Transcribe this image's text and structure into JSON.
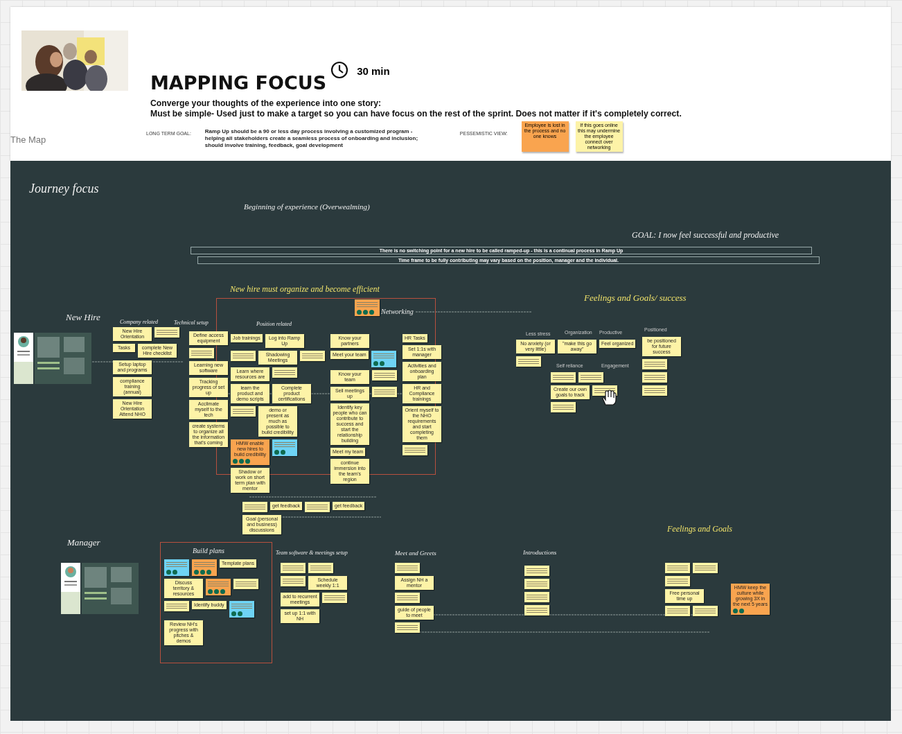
{
  "header": {
    "title": "MAPPING FOCUS",
    "duration": "30 min",
    "instructions": [
      "Converge your thoughts of the experience into one story:",
      "Must be simple- Used just to make a target so you can have focus on the rest of the sprint. Does not matter if it's completely correct."
    ],
    "goal_label": "LONG TERM GOAL:",
    "goal_text": "Ramp Up should be a 90 or less day process involving a customized program - helping all stakeholders create a seamless process of onboarding and inclusion; should involve training, feedback, goal development",
    "pessimistic_label": "PESSEMISTIC VIEW:",
    "pessimistic_notes": [
      {
        "text": "Employee is lost in the process and no one knows",
        "color": "#f9a44f"
      },
      {
        "text": "If this goes online this may undermine the employee connect over networking",
        "color": "#fdf3a7"
      }
    ]
  },
  "frame_label": "The Map",
  "labels": [
    {
      "text": "Journey focus",
      "kind": "script"
    },
    {
      "text": "Beginning of experience (Overwealming)",
      "kind": "script"
    },
    {
      "text": "GOAL:  I now feel successful and productive",
      "kind": "script"
    },
    {
      "text": "New hire must organize and become efficient",
      "kind": "accent"
    },
    {
      "text": "Feelings and Goals/ success",
      "kind": "accent"
    },
    {
      "text": "New Hire",
      "kind": "script"
    },
    {
      "text": "Company related",
      "kind": "script"
    },
    {
      "text": "Technical setup",
      "kind": "script"
    },
    {
      "text": "Position related",
      "kind": "script"
    },
    {
      "text": "Networking",
      "kind": "script"
    },
    {
      "text": "Manager",
      "kind": "script"
    },
    {
      "text": "Build  plans",
      "kind": "script"
    },
    {
      "text": "Team software & meetings setup",
      "kind": "script"
    },
    {
      "text": "Meet and Greets",
      "kind": "script"
    },
    {
      "text": "Introductions",
      "kind": "script"
    },
    {
      "text": "Feelings and Goals",
      "kind": "accent"
    },
    {
      "text": "Less stress",
      "kind": "caption"
    },
    {
      "text": "Organization",
      "kind": "caption"
    },
    {
      "text": "Productive",
      "kind": "caption"
    },
    {
      "text": "Self reliance",
      "kind": "caption"
    },
    {
      "text": "Engagement",
      "kind": "caption"
    },
    {
      "text": "Positioned",
      "kind": "caption"
    }
  ],
  "banners": [
    "There is no switching point for a new hire to be called ramped-up - this is a continual process in Ramp Up",
    "Time frame to be fully contributing may vary based on the position, manager and the individual."
  ],
  "clusters": [
    {
      "notes": [
        {
          "text": "New Hire Orientation",
          "color": "#fdf3a7"
        },
        {
          "color": "#fdf3a7"
        },
        {
          "text": "Tasks",
          "color": "#fdf3a7"
        },
        {
          "text": "complete New Hire checklist",
          "color": "#fdf3a7"
        },
        {
          "text": "Setup laptop and programs",
          "color": "#fdf3a7"
        },
        {
          "text": "compliance training (annual)",
          "color": "#fdf3a7"
        },
        {
          "text": "New Hire Orientation Attend NHO",
          "color": "#fdf3a7"
        }
      ]
    },
    {
      "notes": [
        {
          "text": "Define access equipment",
          "color": "#fdf3a7"
        },
        {
          "color": "#fdf3a7"
        },
        {
          "text": "Learning new software",
          "color": "#fdf3a7"
        },
        {
          "text": "Tracking progress of set up",
          "color": "#fdf3a7"
        },
        {
          "text": "Acclimate myself to the tech",
          "color": "#fdf3a7"
        },
        {
          "text": "create systems to organize all the information that's coming",
          "color": "#fdf3a7"
        }
      ]
    },
    {
      "notes": [
        {
          "text": "Job trainings",
          "color": "#fdf3a7"
        },
        {
          "text": "Log into Ramp Up",
          "color": "#fdf3a7"
        },
        {
          "color": "#fdf3a7"
        },
        {
          "text": "Shadowing Meetings",
          "color": "#fdf3a7"
        },
        {
          "color": "#fdf3a7"
        },
        {
          "text": "Learn where resources are",
          "color": "#fdf3a7"
        },
        {
          "color": "#fdf3a7"
        },
        {
          "text": "learn the product and demo scripts",
          "color": "#fdf3a7"
        },
        {
          "text": "Complete product certifications",
          "color": "#fdf3a7"
        },
        {
          "color": "#fdf3a7"
        },
        {
          "text": "demo or present as much as possible to build credibility",
          "color": "#fdf3a7"
        },
        {
          "text": "HMW enable new hires to build credibility",
          "color": "#f9a44f",
          "dots": [
            {
              "color": "#0f6b4f"
            },
            {
              "color": "#0f6b4f"
            },
            {
              "color": "#0f6b4f"
            }
          ]
        },
        {
          "color": "#6ed3f5",
          "dots": [
            {
              "color": "#0f6b4f"
            },
            {
              "color": "#0f6b4f"
            }
          ]
        },
        {
          "text": "Shadow or work on short term plan with mentor",
          "color": "#fdf3a7"
        }
      ]
    },
    {
      "notes": [
        {
          "text": "Know your partners",
          "color": "#fdf3a7"
        },
        {
          "text": "Meet your team",
          "color": "#fdf3a7"
        },
        {
          "color": "#6ed3f5",
          "dots": [
            {
              "color": "#0f6b4f"
            },
            {
              "color": "#0f6b4f"
            }
          ]
        },
        {
          "text": "Know your team",
          "color": "#fdf3a7"
        },
        {
          "color": "#fdf3a7"
        },
        {
          "text": "Sell meetings up",
          "color": "#fdf3a7"
        },
        {
          "color": "#fdf3a7"
        },
        {
          "text": "Identify key people who can contribute to success and start the relationship building",
          "color": "#fdf3a7"
        },
        {
          "text": "Meet my team",
          "color": "#fdf3a7"
        },
        {
          "text": "continue immersion into the team's region",
          "color": "#fdf3a7"
        }
      ]
    },
    {
      "notes": [
        {
          "text": "HR Tasks",
          "color": "#fdf3a7"
        },
        {
          "text": "Set 1:1s with manager",
          "color": "#fdf3a7"
        },
        {
          "text": "Activities and onboarding plan",
          "color": "#fdf3a7"
        },
        {
          "text": "HR and Compliance trainings",
          "color": "#fdf3a7"
        },
        {
          "text": "Orient myself to the NHO requirements and start completing them",
          "color": "#fdf3a7"
        },
        {
          "color": "#fdf3a7"
        }
      ]
    },
    {
      "notes": [
        {
          "color": "#fdf3a7"
        },
        {
          "text": "get feedback",
          "color": "#fdf3a7"
        },
        {
          "color": "#fdf3a7"
        },
        {
          "text": "get feedback",
          "color": "#fdf3a7"
        },
        {
          "text": "Goal (personal and business) discussions",
          "color": "#fdf3a7"
        }
      ]
    },
    {
      "notes": [
        {
          "text": "No anxiety (or very little)",
          "color": "#fdf3a7"
        },
        {
          "text": "\"make this go away\"",
          "color": "#fdf3a7"
        },
        {
          "text": "Feel organized",
          "color": "#fdf3a7"
        },
        {
          "color": "#fdf3a7"
        }
      ]
    },
    {
      "notes": [
        {
          "color": "#6ed3f5",
          "dots": [
            {
              "color": "#0f6b4f"
            },
            {
              "color": "#0f6b4f"
            }
          ]
        },
        {
          "color": "#f9a44f",
          "dots": [
            {
              "color": "#0f6b4f"
            },
            {
              "color": "#0f6b4f"
            },
            {
              "color": "#0f6b4f"
            }
          ]
        },
        {
          "text": "Template plans",
          "color": "#fdf3a7"
        },
        {
          "text": "Discuss territory & resources",
          "color": "#fdf3a7"
        },
        {
          "color": "#f9a44f",
          "dots": [
            {
              "color": "#0f6b4f"
            },
            {
              "color": "#0f6b4f"
            },
            {
              "color": "#0f6b4f"
            }
          ]
        },
        {
          "color": "#fdf3a7"
        },
        {
          "color": "#fdf3a7"
        },
        {
          "text": "Identify buddy",
          "color": "#fdf3a7"
        },
        {
          "color": "#6ed3f5",
          "dots": [
            {
              "color": "#0f6b4f"
            },
            {
              "color": "#0f6b4f"
            }
          ]
        },
        {
          "text": "Review NH's progress with pitches & demos",
          "color": "#fdf3a7"
        }
      ]
    },
    {
      "notes": [
        {
          "color": "#fdf3a7"
        },
        {
          "color": "#fdf3a7"
        },
        {
          "color": "#fdf3a7"
        },
        {
          "text": "Schedule weekly 1:1",
          "color": "#fdf3a7"
        },
        {
          "text": "add to recurrent meetings",
          "color": "#fdf3a7"
        },
        {
          "color": "#fdf3a7"
        },
        {
          "text": "set up 1:1 with NH",
          "color": "#fdf3a7"
        }
      ]
    },
    {
      "notes": [
        {
          "color": "#fdf3a7"
        },
        {
          "text": "Assign NH a mentor",
          "color": "#fdf3a7"
        },
        {
          "color": "#fdf3a7"
        },
        {
          "text": "guide of people to meet",
          "color": "#fdf3a7"
        },
        {
          "color": "#fdf3a7"
        }
      ]
    },
    {
      "notes": [
        {
          "color": "#fdf3a7"
        },
        {
          "color": "#fdf3a7"
        },
        {
          "color": "#fdf3a7"
        },
        {
          "color": "#fdf3a7"
        }
      ]
    },
    {
      "notes": [
        {
          "color": "#fdf3a7"
        },
        {
          "color": "#fdf3a7"
        },
        {
          "color": "#fdf3a7"
        },
        {
          "text": "Free personal time up",
          "color": "#fdf3a7"
        },
        {
          "color": "#fdf3a7"
        },
        {
          "color": "#fdf3a7"
        }
      ]
    },
    {
      "notes": [
        {
          "text": "HMW keep the culture while growing 3X in the next 5 years",
          "color": "#f9a44f",
          "dots": [
            {
              "color": "#0f6b4f"
            },
            {
              "color": "#0f6b4f"
            }
          ]
        }
      ]
    },
    {
      "notes": [
        {
          "color": "#f9a44f",
          "dots": [
            {
              "color": "#0f6b4f"
            },
            {
              "color": "#0f6b4f"
            },
            {
              "color": "#0f6b4f"
            }
          ]
        }
      ]
    },
    {
      "notes": [
        {
          "text": "be positioned for future success",
          "color": "#fdf3a7"
        },
        {
          "color": "#fdf3a7"
        },
        {
          "color": "#fdf3a7"
        },
        {
          "color": "#fdf3a7"
        }
      ]
    },
    {
      "notes": [
        {
          "color": "#fdf3a7"
        },
        {
          "color": "#fdf3a7"
        },
        {
          "text": "Create our own goals to track",
          "color": "#fdf3a7"
        },
        {
          "color": "#fdf3a7"
        },
        {
          "color": "#fdf3a7"
        }
      ]
    }
  ]
}
